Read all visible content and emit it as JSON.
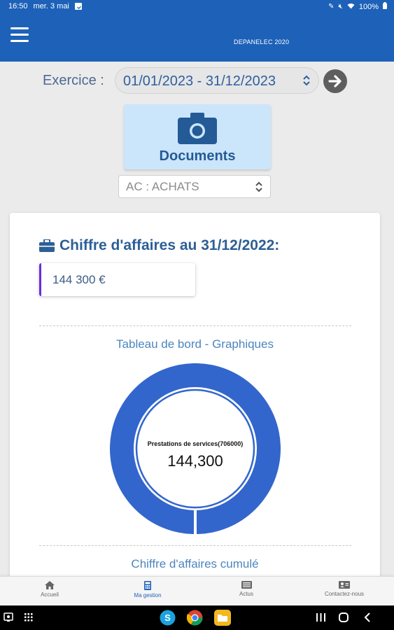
{
  "status_bar": {
    "time": "16:50",
    "date": "mer. 3 mai",
    "battery": "100%"
  },
  "header": {
    "company": "DEPANELEC 2020"
  },
  "exercice": {
    "label": "Exercice :",
    "value": "01/01/2023 - 31/12/2023"
  },
  "documents": {
    "label": "Documents"
  },
  "journal": {
    "selected": "AC : ACHATS"
  },
  "card": {
    "ca_title": "Chiffre d'affaires au 31/12/2022:",
    "ca_value": "144 300 €",
    "dashboard_title": "Tableau de bord - Graphiques",
    "cumul_title": "Chiffre d'affaires cumulé"
  },
  "chart_data": {
    "type": "pie",
    "categories": [
      "Prestations de services(706000)"
    ],
    "values": [
      144300
    ],
    "center_label": "Prestations de services(706000)",
    "center_value": "144,300",
    "colors": [
      "#3366cc"
    ]
  },
  "bottom_nav": {
    "items": [
      {
        "label": "Accueil",
        "icon": "home-icon"
      },
      {
        "label": "Ma gestion",
        "icon": "calculator-icon"
      },
      {
        "label": "Actus",
        "icon": "news-icon"
      },
      {
        "label": "Contactez-nous",
        "icon": "contact-card-icon"
      }
    ]
  },
  "colors": {
    "primary": "#1d61b8",
    "accent_border": "#6a2de0",
    "donut": "#3366cc",
    "documents_bg": "#cbe5fb"
  }
}
